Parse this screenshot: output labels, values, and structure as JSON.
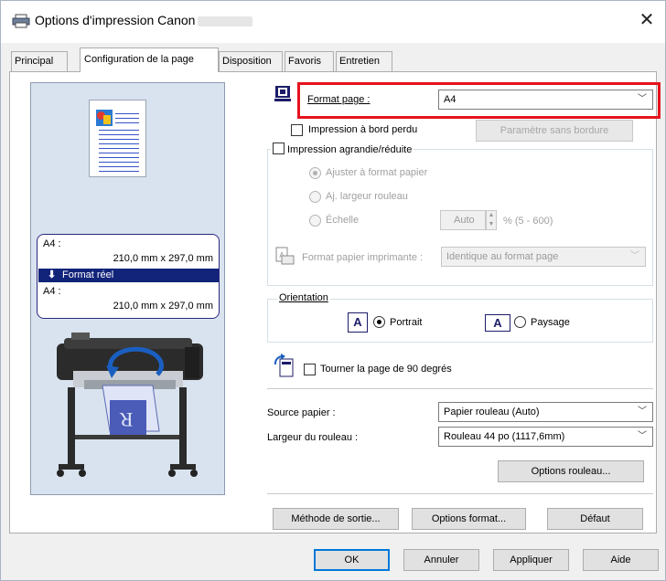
{
  "window": {
    "title": "Options d'impression Canon",
    "close_glyph": "✕"
  },
  "tabs": [
    {
      "label": "Principal"
    },
    {
      "label": "Configuration de la page"
    },
    {
      "label": "Disposition"
    },
    {
      "label": "Favoris"
    },
    {
      "label": "Entretien"
    }
  ],
  "preview": {
    "page_size_line1": "A4 :",
    "page_size_line2": "210,0 mm x 297,0 mm",
    "band_label": "Format réel",
    "real_size_line1": "A4 :",
    "real_size_line2": "210,0 mm x 297,0 mm",
    "paper_letter": "R"
  },
  "settings": {
    "format_page_label": "Format page :",
    "format_page_value": "A4",
    "borderless_label": "Impression à bord perdu",
    "borderless_button": "Paramètre sans bordure",
    "scaled_label": "Impression agrandie/réduite",
    "fit_paper_label": "Ajuster à format papier",
    "fit_roll_label": "Aj. largeur rouleau",
    "scale_label": "Échelle",
    "scale_value": "Auto",
    "scale_range": "% (5 - 600)",
    "printer_paper_label": "Format papier imprimante :",
    "printer_paper_value": "Identique au format page",
    "orientation_group": "Orientation",
    "portrait_label": "Portrait",
    "landscape_label": "Paysage",
    "rotate_label": "Tourner la page de 90 degrés",
    "source_label": "Source papier :",
    "source_value": "Papier rouleau (Auto)",
    "roll_width_label": "Largeur du rouleau :",
    "roll_width_value": "Rouleau 44 po (1117,6mm)",
    "roll_options_button": "Options rouleau..."
  },
  "bottom_buttons": {
    "output_method": "Méthode de sortie...",
    "format_options": "Options format...",
    "default": "Défaut"
  },
  "dialog_buttons": {
    "ok": "OK",
    "cancel": "Annuler",
    "apply": "Appliquer",
    "help": "Aide"
  },
  "colors": {
    "highlight": "#e5131d",
    "accent": "#0078d7",
    "band": "#12237a"
  }
}
